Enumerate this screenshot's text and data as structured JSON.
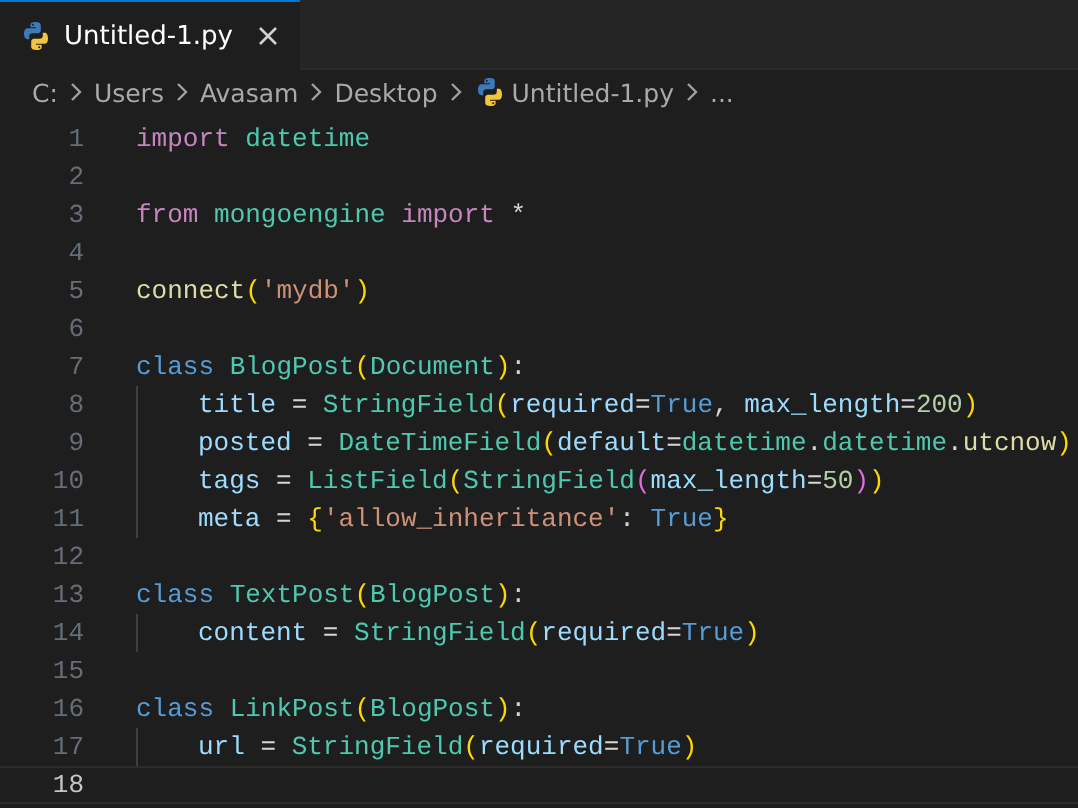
{
  "tabs": [
    {
      "label": "Untitled-1.py",
      "selected": true
    }
  ],
  "breadcrumbs": [
    {
      "label": "C:",
      "kind": "folder"
    },
    {
      "label": "Users",
      "kind": "folder"
    },
    {
      "label": "Avasam",
      "kind": "folder"
    },
    {
      "label": "Desktop",
      "kind": "folder"
    },
    {
      "label": "Untitled-1.py",
      "kind": "file"
    },
    {
      "label": "...",
      "kind": "symbol"
    }
  ],
  "lines": [
    {
      "number": "1",
      "current": false,
      "indented": false,
      "tokens": [
        {
          "kind": "kw",
          "text": "import "
        },
        {
          "kind": "cls",
          "text": "datetime"
        }
      ]
    },
    {
      "number": "2",
      "current": false,
      "indented": false
    },
    {
      "number": "3",
      "current": false,
      "indented": false,
      "tokens": [
        {
          "kind": "kw",
          "text": "from "
        },
        {
          "kind": "cls",
          "text": "mongoengine "
        },
        {
          "kind": "kw",
          "text": "import "
        },
        {
          "kind": "op",
          "text": "*"
        }
      ]
    },
    {
      "number": "4",
      "current": false,
      "indented": false
    },
    {
      "number": "5",
      "current": false,
      "indented": false,
      "tokens": [
        {
          "kind": "fn",
          "text": "connect"
        },
        {
          "kind": "b1",
          "text": "("
        },
        {
          "kind": "str",
          "text": "'mydb'"
        },
        {
          "kind": "b1",
          "text": ")"
        }
      ]
    },
    {
      "number": "6",
      "current": false,
      "indented": false
    },
    {
      "number": "7",
      "current": false,
      "indented": false,
      "tokens": [
        {
          "kind": "st",
          "text": "class "
        },
        {
          "kind": "cls",
          "text": "BlogPost"
        },
        {
          "kind": "b1",
          "text": "("
        },
        {
          "kind": "cls",
          "text": "Document"
        },
        {
          "kind": "b1",
          "text": ")"
        },
        {
          "kind": "op",
          "text": ":"
        }
      ]
    },
    {
      "number": "8",
      "current": false,
      "indented": true,
      "tokens": [
        {
          "kind": "var",
          "text": "title"
        },
        {
          "kind": "op",
          "text": " = "
        },
        {
          "kind": "cls",
          "text": "StringField"
        },
        {
          "kind": "b1",
          "text": "("
        },
        {
          "kind": "var",
          "text": "required"
        },
        {
          "kind": "op",
          "text": "="
        },
        {
          "kind": "st",
          "text": "True"
        },
        {
          "kind": "op",
          "text": ", "
        },
        {
          "kind": "var",
          "text": "max_length"
        },
        {
          "kind": "op",
          "text": "="
        },
        {
          "kind": "num",
          "text": "200"
        },
        {
          "kind": "b1",
          "text": ")"
        }
      ]
    },
    {
      "number": "9",
      "current": false,
      "indented": true,
      "tokens": [
        {
          "kind": "var",
          "text": "posted"
        },
        {
          "kind": "op",
          "text": " = "
        },
        {
          "kind": "cls",
          "text": "DateTimeField"
        },
        {
          "kind": "b1",
          "text": "("
        },
        {
          "kind": "var",
          "text": "default"
        },
        {
          "kind": "op",
          "text": "="
        },
        {
          "kind": "cls",
          "text": "datetime"
        },
        {
          "kind": "op",
          "text": "."
        },
        {
          "kind": "cls",
          "text": "datetime"
        },
        {
          "kind": "op",
          "text": "."
        },
        {
          "kind": "fn",
          "text": "utcnow"
        },
        {
          "kind": "b1",
          "text": ")"
        }
      ]
    },
    {
      "number": "10",
      "current": false,
      "indented": true,
      "tokens": [
        {
          "kind": "var",
          "text": "tags"
        },
        {
          "kind": "op",
          "text": " = "
        },
        {
          "kind": "cls",
          "text": "ListField"
        },
        {
          "kind": "b1",
          "text": "("
        },
        {
          "kind": "cls",
          "text": "StringField"
        },
        {
          "kind": "b2",
          "text": "("
        },
        {
          "kind": "var",
          "text": "max_length"
        },
        {
          "kind": "op",
          "text": "="
        },
        {
          "kind": "num",
          "text": "50"
        },
        {
          "kind": "b2",
          "text": ")"
        },
        {
          "kind": "b1",
          "text": ")"
        }
      ]
    },
    {
      "number": "11",
      "current": false,
      "indented": true,
      "tokens": [
        {
          "kind": "var",
          "text": "meta"
        },
        {
          "kind": "op",
          "text": " = "
        },
        {
          "kind": "b1",
          "text": "{"
        },
        {
          "kind": "str",
          "text": "'allow_inheritance'"
        },
        {
          "kind": "op",
          "text": ": "
        },
        {
          "kind": "st",
          "text": "True"
        },
        {
          "kind": "b1",
          "text": "}"
        }
      ]
    },
    {
      "number": "12",
      "current": false,
      "indented": false
    },
    {
      "number": "13",
      "current": false,
      "indented": false,
      "tokens": [
        {
          "kind": "st",
          "text": "class "
        },
        {
          "kind": "cls",
          "text": "TextPost"
        },
        {
          "kind": "b1",
          "text": "("
        },
        {
          "kind": "cls",
          "text": "BlogPost"
        },
        {
          "kind": "b1",
          "text": ")"
        },
        {
          "kind": "op",
          "text": ":"
        }
      ]
    },
    {
      "number": "14",
      "current": false,
      "indented": true,
      "tokens": [
        {
          "kind": "var",
          "text": "content"
        },
        {
          "kind": "op",
          "text": " = "
        },
        {
          "kind": "cls",
          "text": "StringField"
        },
        {
          "kind": "b1",
          "text": "("
        },
        {
          "kind": "var",
          "text": "required"
        },
        {
          "kind": "op",
          "text": "="
        },
        {
          "kind": "st",
          "text": "True"
        },
        {
          "kind": "b1",
          "text": ")"
        }
      ]
    },
    {
      "number": "15",
      "current": false,
      "indented": false
    },
    {
      "number": "16",
      "current": false,
      "indented": false,
      "tokens": [
        {
          "kind": "st",
          "text": "class "
        },
        {
          "kind": "cls",
          "text": "LinkPost"
        },
        {
          "kind": "b1",
          "text": "("
        },
        {
          "kind": "cls",
          "text": "BlogPost"
        },
        {
          "kind": "b1",
          "text": ")"
        },
        {
          "kind": "op",
          "text": ":"
        }
      ]
    },
    {
      "number": "17",
      "current": false,
      "indented": true,
      "tokens": [
        {
          "kind": "var",
          "text": "url"
        },
        {
          "kind": "op",
          "text": " = "
        },
        {
          "kind": "cls",
          "text": "StringField"
        },
        {
          "kind": "b1",
          "text": "("
        },
        {
          "kind": "var",
          "text": "required"
        },
        {
          "kind": "op",
          "text": "="
        },
        {
          "kind": "st",
          "text": "True"
        },
        {
          "kind": "b1",
          "text": ")"
        }
      ]
    },
    {
      "number": "18",
      "current": true,
      "indented": false
    }
  ]
}
